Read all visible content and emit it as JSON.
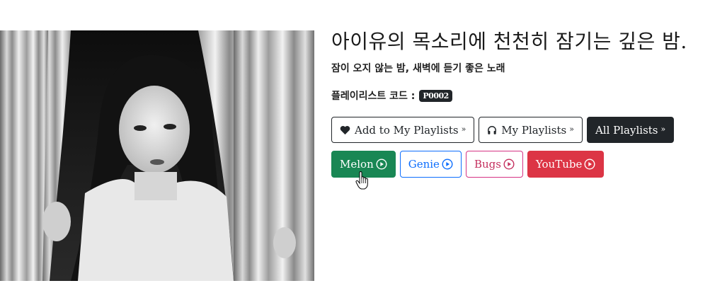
{
  "playlist": {
    "title": "아이유의 목소리에 천천히 잠기는 깊은 밤.",
    "subtitle": "잠이 오지 않는 밤, 새벽에 듣기 좋은 노래",
    "code_label": "플레이리스트 코드 :",
    "code_value": "P0002"
  },
  "actions": {
    "add": "Add to My Playlists",
    "my": "My Playlists",
    "all": "All Playlists",
    "chevron": "»"
  },
  "services": {
    "melon": "Melon",
    "genie": "Genie",
    "bugs": "Bugs",
    "youtube": "YouTube"
  },
  "colors": {
    "melon": "#198754",
    "genie": "#0d6efd",
    "bugs": "#d63384",
    "youtube": "#dc3545",
    "dark": "#212529"
  },
  "icons": [
    "heart-icon",
    "headphones-icon",
    "play-circle-icon",
    "hand-cursor-icon"
  ]
}
